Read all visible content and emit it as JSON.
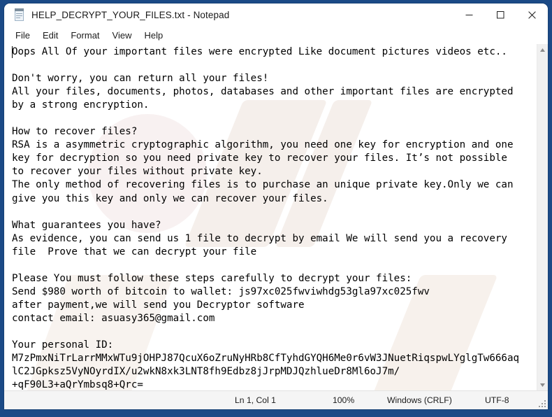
{
  "window": {
    "title": "HELP_DECRYPT_YOUR_FILES.txt - Notepad",
    "app_icon": "notepad-icon",
    "minimize_label": "Minimize",
    "maximize_label": "Maximize",
    "close_label": "Close"
  },
  "menu": {
    "items": [
      {
        "label": "File"
      },
      {
        "label": "Edit"
      },
      {
        "label": "Format"
      },
      {
        "label": "View"
      },
      {
        "label": "Help"
      }
    ]
  },
  "document": {
    "lines": [
      "Oops All Of your important files were encrypted Like document pictures videos etc..",
      "",
      "Don't worry, you can return all your files!",
      "All your files, documents, photos, databases and other important files are encrypted",
      "by a strong encryption.",
      "",
      "How to recover files?",
      "RSA is a asymmetric cryptographic algorithm, you need one key for encryption and one",
      "key for decryption so you need private key to recover your files. It’s not possible",
      "to recover your files without private key.",
      "The only method of recovering files is to purchase an unique private key.Only we can",
      "give you this key and only we can recover your files.",
      "",
      "What guarantees you have?",
      "As evidence, you can send us 1 file to decrypt by email We will send you a recovery",
      "file  Prove that we can decrypt your file",
      "",
      "Please You must follow these steps carefully to decrypt your files:",
      "Send $980 worth of bitcoin to wallet: js97xc025fwviwhdg53gla97xc025fwv",
      "after payment,we will send you Decryptor software",
      "contact email: asuasy365@gmail.com",
      "",
      "Your personal ID:",
      "M7zPmxNiTrLarrMMxWTu9jOHPJ87QcuX6oZruNyHRb8CfTyhdGYQH6Me0r6vW3JNuetRiqspwLYglgTw666aq",
      "lC2JGpksz5VyNOyrdIX/u2wkN8xk3LNT8fh9Edbz8jJrpMDJQzhlueDr8Ml6oJ7m/",
      "+qF90L3+aQrYmbsq8+Qrc="
    ],
    "ransom_amount": "$980",
    "bitcoin_wallet": "js97xc025fwviwhdg53gla97xc025fwv",
    "contact_email": "asuasy365@gmail.com",
    "personal_id": "M7zPmxNiTrLarrMMxWTu9jOHPJ87QcuX6oZruNyHRb8CfTyhdGYQH6Me0r6vW3JNuetRiqspwLYglgTw666aqlC2JGpksz5VyNOyrdIX/u2wkN8xk3LNT8fh9Edbz8jJrpMDJQzhlueDr8Ml6oJ7m/+qF90L3+aQrYmbsq8+Qrc="
  },
  "scrollbar": {
    "up_arrow": "scroll-up-icon",
    "down_arrow": "scroll-down-icon"
  },
  "statusbar": {
    "cursor_position": "Ln 1, Col 1",
    "zoom": "100%",
    "line_ending": "Windows (CRLF)",
    "encoding": "UTF-8"
  },
  "colors": {
    "desktop": "#1b4a86",
    "window": "#ffffff",
    "statusbar": "#f5f5f5",
    "text": "#000000"
  }
}
